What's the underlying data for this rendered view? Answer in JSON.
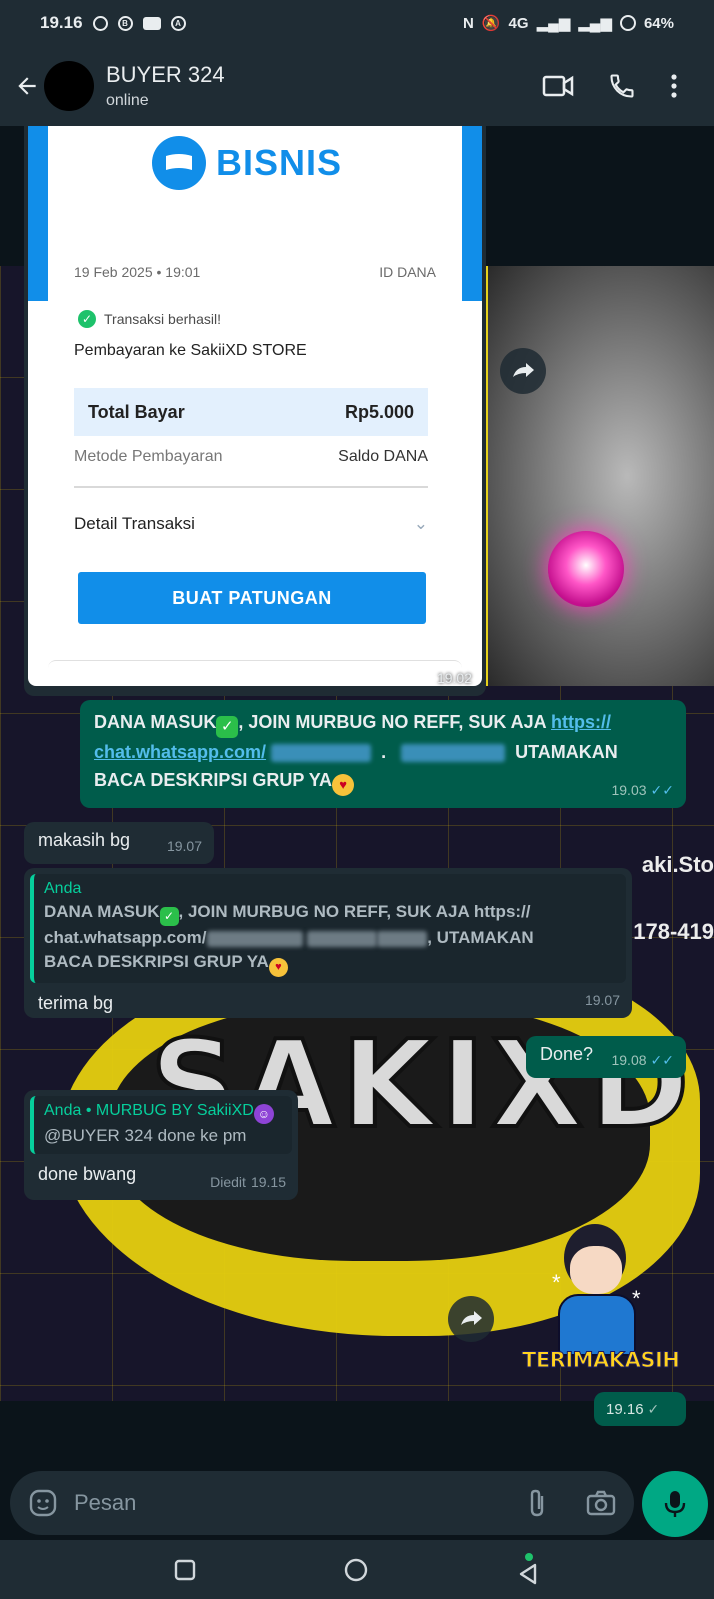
{
  "statusbar": {
    "time": "19.16",
    "network": "4G",
    "battery": "64%"
  },
  "header": {
    "contact_name": "BUYER 324",
    "contact_status": "online"
  },
  "receipt": {
    "brand": "BISNIS",
    "date": "19 Feb 2025 • 19:01",
    "id_label": "ID DANA",
    "success": "Transaksi berhasil!",
    "payment_to": "Pembayaran ke SakiiXD STORE",
    "total_label": "Total Bayar",
    "total_amount": "Rp5.000",
    "method_label": "Metode Pembayaran",
    "method_value": "Saldo DANA",
    "detail_label": "Detail Transaksi",
    "button_label": "BUAT PATUNGAN",
    "time": "19.02"
  },
  "wallpaper": {
    "text1": "aki.Sto",
    "text2": "178-419",
    "logo": "SAKIXD"
  },
  "messages": {
    "m1": {
      "text_a": "DANA MASUK",
      "text_b": ", JOIN MURBUG NO REFF, SUK AJA ",
      "link_a": "https://",
      "link_b": "chat.whatsapp.com",
      "text_c": "UTAMAKAN",
      "text_d": "BACA DESKRIPSI GRUP YA",
      "time": "19.03"
    },
    "m2": {
      "text": "makasih bg",
      "time": "19.07"
    },
    "m3": {
      "quote_name": "Anda",
      "quote_a": "DANA MASUK",
      "quote_b": ", JOIN MURBUG NO REFF, SUK AJA https://",
      "quote_c": "chat.whatsapp.com",
      "quote_d": ", UTAMAKAN",
      "quote_e": "BACA DESKRIPSI GRUP YA",
      "text": "terima bg",
      "time": "19.07"
    },
    "m4": {
      "text": "Done?",
      "time": "19.08"
    },
    "m5": {
      "quote_name": "Anda • MURBUG BY SakiiXD",
      "quote_text": "@BUYER 324 done ke pm",
      "text": "done bwang",
      "edited": "Diedit",
      "time": "19.15"
    },
    "sticker": {
      "label": "TERIMAKASIH",
      "time": "19.16"
    }
  },
  "composer": {
    "placeholder": "Pesan"
  },
  "colors": {
    "outgoing": "#005c4b",
    "incoming": "#1f2c34",
    "accent": "#00a884",
    "dana_blue": "#118ee9"
  }
}
